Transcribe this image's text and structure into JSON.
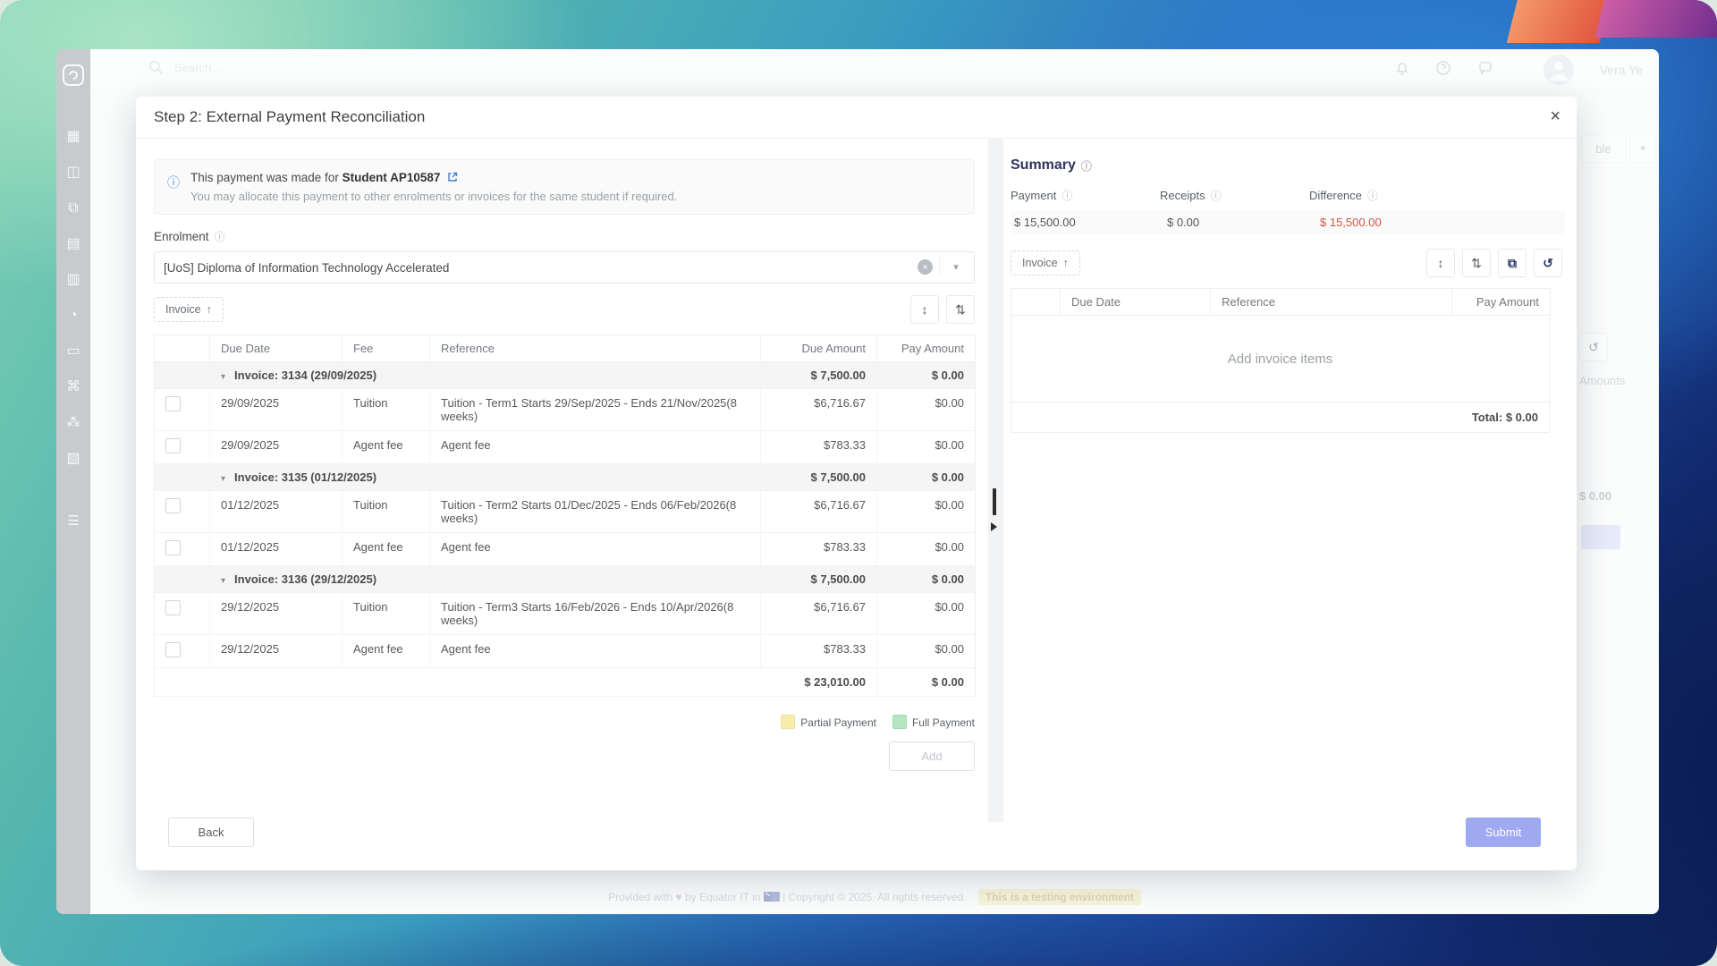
{
  "icons": {
    "close": "×",
    "info": "ⓘ",
    "caret_down": "▾",
    "group_caret": "▾",
    "sort_up": "↑",
    "clear": "×",
    "expand": "↕",
    "collapse": "⇅",
    "copy": "⧉",
    "restore": "↺",
    "heart": "♥"
  },
  "topbar": {
    "search_placeholder": "Search...",
    "user_name": "Vera Ye"
  },
  "sidebar": {
    "items": [
      {
        "name": "dashboard",
        "glyph": "▦"
      },
      {
        "name": "students",
        "glyph": "◫"
      },
      {
        "name": "applications",
        "glyph": "⧉"
      },
      {
        "name": "timetables",
        "glyph": "▤"
      },
      {
        "name": "invoices",
        "glyph": "▥"
      },
      {
        "name": "courses",
        "glyph": "◔"
      },
      {
        "name": "library",
        "glyph": "▭"
      },
      {
        "name": "services",
        "glyph": "⌘"
      },
      {
        "name": "agents",
        "glyph": "⁂"
      },
      {
        "name": "organisation",
        "glyph": "▧"
      },
      {
        "name": "settings",
        "glyph": "☰"
      }
    ]
  },
  "modal": {
    "title": "Step 2: External Payment Reconciliation",
    "banner": {
      "line1_prefix": "This payment was made for",
      "student": "Student AP10587",
      "line2": "You may allocate this payment to other enrolments or invoices for the same student if required."
    },
    "enrolment": {
      "label": "Enrolment",
      "value": "[UoS] Diploma of Information Technology Accelerated"
    },
    "left_table": {
      "sort_chip": "Invoice",
      "columns": [
        "",
        "Due Date",
        "Fee",
        "Reference",
        "Due Amount",
        "Pay Amount"
      ],
      "groups": [
        {
          "label": "Invoice: 3134 (29/09/2025)",
          "due": "$ 7,500.00",
          "pay": "$ 0.00",
          "rows": [
            {
              "date": "29/09/2025",
              "fee": "Tuition",
              "ref": "Tuition - Term1 Starts 29/Sep/2025 - Ends 21/Nov/2025(8 weeks)",
              "due": "$6,716.67",
              "pay": "$0.00"
            },
            {
              "date": "29/09/2025",
              "fee": "Agent fee",
              "ref": "Agent fee",
              "due": "$783.33",
              "pay": "$0.00"
            }
          ]
        },
        {
          "label": "Invoice: 3135 (01/12/2025)",
          "due": "$ 7,500.00",
          "pay": "$ 0.00",
          "rows": [
            {
              "date": "01/12/2025",
              "fee": "Tuition",
              "ref": "Tuition - Term2 Starts 01/Dec/2025 - Ends 06/Feb/2026(8 weeks)",
              "due": "$6,716.67",
              "pay": "$0.00"
            },
            {
              "date": "01/12/2025",
              "fee": "Agent fee",
              "ref": "Agent fee",
              "due": "$783.33",
              "pay": "$0.00"
            }
          ]
        },
        {
          "label": "Invoice: 3136 (29/12/2025)",
          "due": "$ 7,500.00",
          "pay": "$ 0.00",
          "rows": [
            {
              "date": "29/12/2025",
              "fee": "Tuition",
              "ref": "Tuition - Term3 Starts 16/Feb/2026 - Ends 10/Apr/2026(8 weeks)",
              "due": "$6,716.67",
              "pay": "$0.00"
            },
            {
              "date": "29/12/2025",
              "fee": "Agent fee",
              "ref": "Agent fee",
              "due": "$783.33",
              "pay": "$0.00"
            }
          ]
        }
      ],
      "total_due": "$ 23,010.00",
      "total_pay": "$ 0.00",
      "legend": [
        {
          "label": "Partial Payment",
          "color": "#f7edaa"
        },
        {
          "label": "Full Payment",
          "color": "#b5e6bf"
        }
      ],
      "add_label": "Add"
    },
    "summary": {
      "title": "Summary",
      "metrics": [
        {
          "label": "Payment",
          "value": "$ 15,500.00"
        },
        {
          "label": "Receipts",
          "value": "$ 0.00"
        },
        {
          "label": "Difference",
          "value": "$ 15,500.00",
          "value_color": "#cf5747"
        }
      ],
      "sort_chip": "Invoice",
      "columns": [
        "",
        "Due Date",
        "Reference",
        "Pay Amount"
      ],
      "empty_text": "Add invoice items",
      "total_label": "Total: $ 0.00"
    },
    "footer_buttons": {
      "back": "Back",
      "submit": "Submit"
    }
  },
  "app_footer": {
    "prefix": "Provided with",
    "mid": "by Equator IT in",
    "copyright": "| Copyright © 2025. All rights reserved.",
    "badge": "This is a testing environment"
  },
  "fragments": {
    "button": "ble",
    "caret": "▾",
    "amounts": "Amounts",
    "total": "$ 0.00"
  },
  "colors": {
    "submit": "#9fa9f0",
    "difference": "#cf5747",
    "summary_heading": "#2e3560",
    "partial_payment": "#f7edaa",
    "full_payment": "#b5e6bf"
  }
}
